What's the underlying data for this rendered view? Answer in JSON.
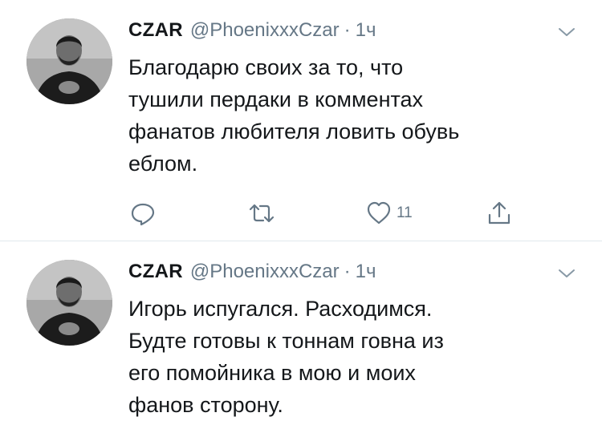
{
  "tweets": [
    {
      "name": "CZAR",
      "handle": "@PhoenixxxCzar",
      "separator": "·",
      "time": "1ч",
      "text": "Благодарю своих за то, что\nтушили пердаки в комментах\nфанатов любителя ловить обувь\nеблом.",
      "like_count": "11",
      "icons": {
        "reply": "reply-icon",
        "retweet": "retweet-icon",
        "like": "heart-icon",
        "share": "share-icon",
        "menu": "chevron-down-icon"
      }
    },
    {
      "name": "CZAR",
      "handle": "@PhoenixxxCzar",
      "separator": "·",
      "time": "1ч",
      "text": "Игорь испугался. Расходимся.\nБудте готовы к тоннам говна из\nего помойника в мою и моих\nфанов сторону.",
      "icons": {
        "menu": "chevron-down-icon"
      }
    }
  ],
  "colors": {
    "text_primary": "#14171a",
    "text_secondary": "#657786",
    "divider": "#e1e8ed",
    "background": "#ffffff"
  }
}
